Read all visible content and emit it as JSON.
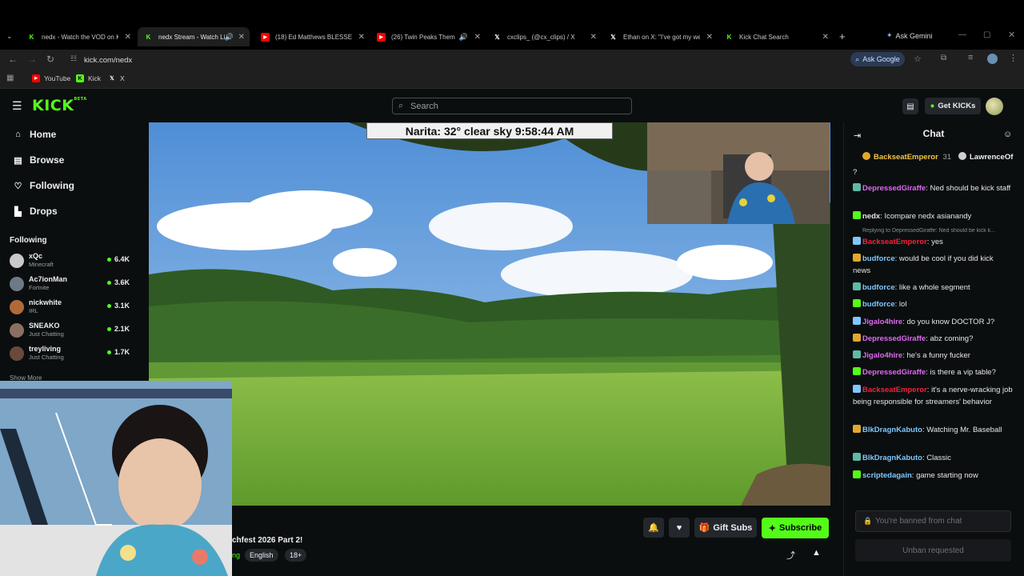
{
  "browser": {
    "tabs": [
      {
        "title": "nedx - Watch the VOD on K",
        "icon": "kick-favicon",
        "active": false
      },
      {
        "title": "nedx Stream - Watch Li",
        "icon": "kick-favicon",
        "active": true
      },
      {
        "title": "(18) Ed Matthews BLESSES",
        "icon": "youtube-favicon",
        "active": false
      },
      {
        "title": "(26) Twin Peaks Theme",
        "icon": "youtube-favicon",
        "active": false
      },
      {
        "title": "cxclips_ (@cx_clips) / X",
        "icon": "x-favicon",
        "active": false
      },
      {
        "title": "Ethan on X: \"I've got my we",
        "icon": "x-favicon",
        "active": false
      },
      {
        "title": "Kick Chat Search",
        "icon": "kick-favicon",
        "active": false
      }
    ],
    "ask_gemini": "Ask Gemini",
    "url": "kick.com/nedx",
    "ask_google": "Ask Google",
    "bookmarks": [
      {
        "label": "YouTube",
        "icon": "youtube-favicon"
      },
      {
        "label": "Kick",
        "icon": "kick-favicon"
      },
      {
        "label": "X",
        "icon": "x-favicon"
      }
    ]
  },
  "header": {
    "logo": "KICK",
    "logo_badge": "BETA",
    "search_placeholder": "Search",
    "get_kicks": "Get KICKs"
  },
  "sidebar": {
    "nav": [
      {
        "label": "Home",
        "icon": "home-icon"
      },
      {
        "label": "Browse",
        "icon": "browse-icon"
      },
      {
        "label": "Following",
        "icon": "heart-icon"
      },
      {
        "label": "Drops",
        "icon": "drops-icon"
      }
    ],
    "following_heading": "Following",
    "following": [
      {
        "name": "xQc",
        "category": "Minecraft",
        "viewers": "6.4K"
      },
      {
        "name": "Ac7ionMan",
        "category": "Fortnite",
        "viewers": "3.6K"
      },
      {
        "name": "nickwhite",
        "category": "IRL",
        "viewers": "3.1K"
      },
      {
        "name": "SNEAKO",
        "category": "Just Chatting",
        "viewers": "2.1K"
      },
      {
        "name": "treyliving",
        "category": "Just Chatting",
        "viewers": "1.7K"
      }
    ],
    "show_more": "Show More"
  },
  "player": {
    "weather_overlay": "Narita: 32°  clear sky 9:58:44 AM"
  },
  "stream_info": {
    "title_fragment": "chfest 2026 Part 2!",
    "category_fragment": "ng",
    "tags": [
      "English",
      "18+"
    ],
    "gift_subs": "Gift Subs",
    "subscribe": "Subscribe"
  },
  "chat": {
    "title": "Chat",
    "pinned": [
      {
        "name": "BackseatEmperor",
        "count": "31",
        "color": "#f5c542"
      },
      {
        "name": "LawrenceOf",
        "color": "#e6e6e6"
      }
    ],
    "stray": "?",
    "reply_hint": "Replying to DepressedGiraffe: Ned should be kick k...",
    "messages": [
      {
        "user": "DepressedGiraffe",
        "color": "#dc6cf0",
        "text": "Ned should be kick staff"
      },
      {
        "user": "nedx",
        "color": "#e6e6e6",
        "text": "Icompare nedx asianandy"
      },
      {
        "user": "BackseatEmperor",
        "color": "#f5213c",
        "text": "yes"
      },
      {
        "user": "budforce",
        "color": "#7fc8ff",
        "text": "would be cool if you did kick news"
      },
      {
        "user": "budforce",
        "color": "#7fc8ff",
        "text": "like a whole segment"
      },
      {
        "user": "budforce",
        "color": "#7fc8ff",
        "text": "lol"
      },
      {
        "user": "Jigalo4hire",
        "color": "#dc6cf0",
        "text": "do you know DOCTOR J?"
      },
      {
        "user": "DepressedGiraffe",
        "color": "#dc6cf0",
        "text": "abz coming?"
      },
      {
        "user": "Jigalo4hire",
        "color": "#dc6cf0",
        "text": "he's a funny fucker"
      },
      {
        "user": "DepressedGiraffe",
        "color": "#dc6cf0",
        "text": "is there a vip table?"
      },
      {
        "user": "BackseatEmperor",
        "color": "#f5213c",
        "text": "it's a nerve-wracking job being responsible for streamers' behavior"
      },
      {
        "user": "BlkDragnKabuto",
        "color": "#7fc8ff",
        "text": "Watching Mr. Baseball"
      },
      {
        "user": "BlkDragnKabuto",
        "color": "#7fc8ff",
        "text": "Classic"
      },
      {
        "user": "scriptedagain",
        "color": "#7fc8ff",
        "text": "game starting now"
      }
    ],
    "input_placeholder": "You're banned from chat",
    "unban": "Unban requested"
  },
  "colors": {
    "accent": "#53fc18",
    "bg": "#0b0e0f"
  }
}
